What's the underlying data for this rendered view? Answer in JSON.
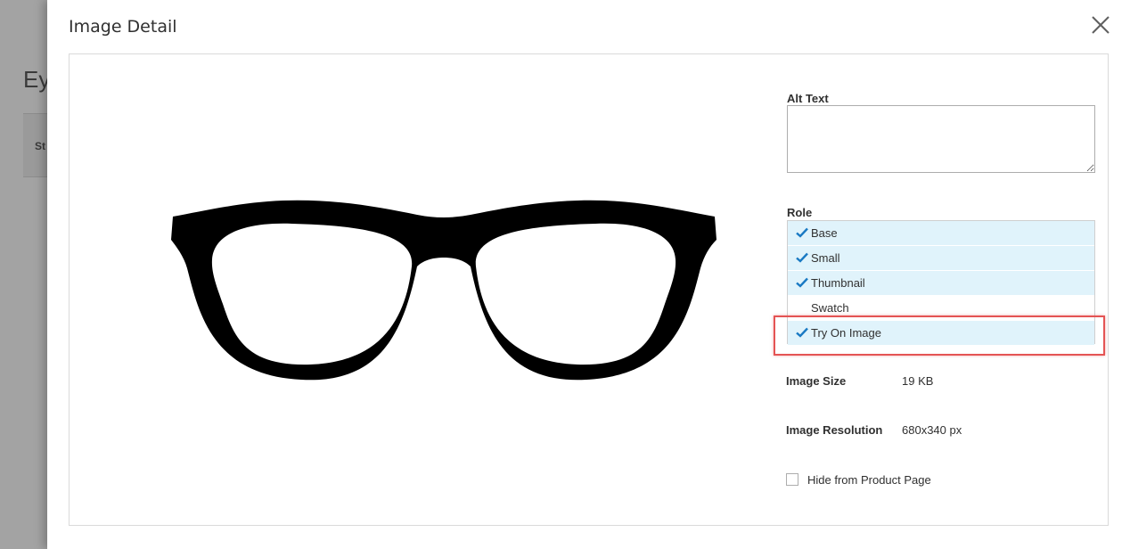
{
  "background_page": {
    "title_fragment": "Ey",
    "bar_text_fragment": "St"
  },
  "modal": {
    "title": "Image Detail",
    "close_icon": "close-icon"
  },
  "image": {
    "icon": "eyeglasses-image",
    "color": "#000000"
  },
  "form": {
    "alt_text_label": "Alt Text",
    "alt_text_value": "",
    "role_label": "Role",
    "roles": [
      {
        "label": "Base",
        "selected": true
      },
      {
        "label": "Small",
        "selected": true
      },
      {
        "label": "Thumbnail",
        "selected": true
      },
      {
        "label": "Swatch",
        "selected": false
      },
      {
        "label": "Try On Image",
        "selected": true
      }
    ],
    "image_size_label": "Image Size",
    "image_size_value": "19 KB",
    "image_resolution_label": "Image Resolution",
    "image_resolution_value": "680x340 px",
    "hide_label": "Hide from Product Page",
    "hide_checked": false
  },
  "colors": {
    "selected_row": "#e0f3fb",
    "check": "#1979c3",
    "highlight": "#e45454"
  }
}
